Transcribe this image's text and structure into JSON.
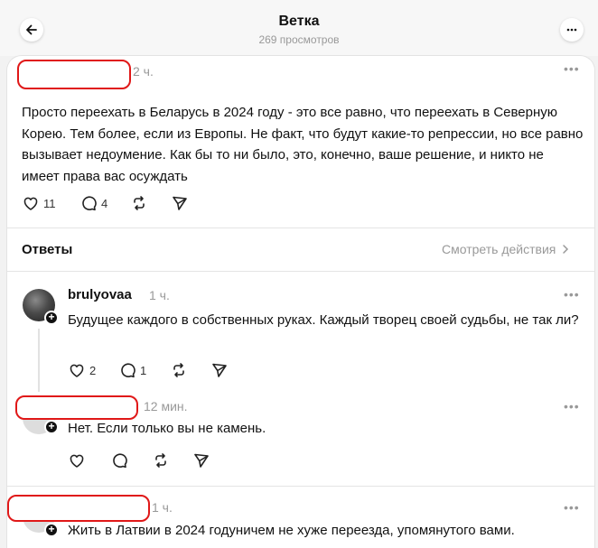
{
  "header": {
    "title": "Ветка",
    "views": "269 просмотров"
  },
  "main_post": {
    "time": "2 ч.",
    "text": "Просто переехать в Беларусь в 2024 году - это все равно, что переехать в Северную Корею. Тем более, если из Европы. Не факт, что будут какие-то репрессии, но все равно вызывает недоумение. Как бы то ни было, это, конечно, ваше решение, и никто не имеет права вас осуждать",
    "likes": "11",
    "replies": "4"
  },
  "replies_section": {
    "title": "Ответы",
    "view_activity": "Смотреть действия"
  },
  "replies": [
    {
      "author": "brulyovaa",
      "time": "1 ч.",
      "text": "Будущее каждого в собственных руках. Каждый творец своей судьбы, не так ли?",
      "likes": "2",
      "replies": "1"
    },
    {
      "time": "12 мин.",
      "text": "Нет. Если только вы не камень."
    },
    {
      "time": "1 ч.",
      "text": "Жить в Латвии в 2024 годуничем не хуже переезда, упомянутого вами."
    }
  ],
  "icons": [
    "back-arrow-icon",
    "more-icon",
    "heart-icon",
    "comment-icon",
    "repost-icon",
    "share-icon",
    "chevron-right-icon"
  ],
  "colors": {
    "redaction": "#e01818",
    "muted": "#999999"
  }
}
